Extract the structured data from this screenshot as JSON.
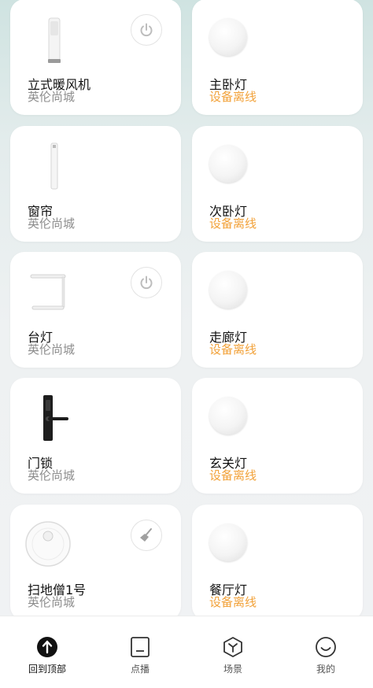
{
  "devices_left": [
    {
      "name": "立式暖风机",
      "location": "英伦尚城",
      "has_power": true
    },
    {
      "name": "窗帘",
      "location": "英伦尚城",
      "has_power": false
    },
    {
      "name": "台灯",
      "location": "英伦尚城",
      "has_power": true
    },
    {
      "name": "门锁",
      "location": "英伦尚城",
      "has_power": false
    },
    {
      "name": "扫地僧1号",
      "location": "英伦尚城",
      "has_clean": true
    }
  ],
  "devices_right": [
    {
      "name": "主卧灯",
      "status": "设备离线"
    },
    {
      "name": "次卧灯",
      "status": "设备离线"
    },
    {
      "name": "走廊灯",
      "status": "设备离线"
    },
    {
      "name": "玄关灯",
      "status": "设备离线"
    },
    {
      "name": "餐厅灯",
      "status": "设备离线"
    }
  ],
  "tabbar": {
    "back_to_top": "回到顶部",
    "live": "点播",
    "scene": "场景",
    "mine": "我的"
  },
  "colors": {
    "offline": "#f2a23a",
    "accent": "#111111"
  }
}
